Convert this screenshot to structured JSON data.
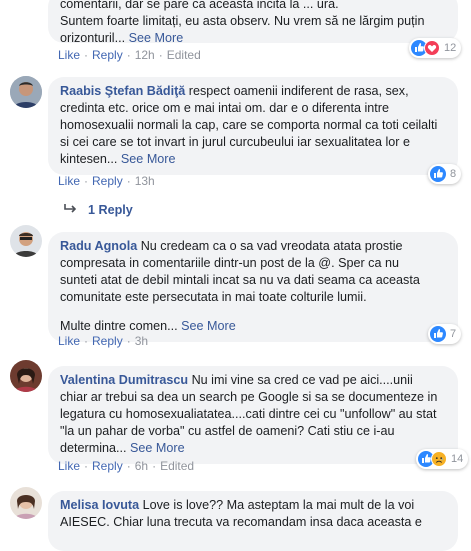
{
  "comments": [
    {
      "author": "",
      "lines": [
        "comentarii, dar se pare ca aceasta incita la ... ura.",
        "Suntem foarte limitați, eu asta observ. Nu vrem să ne lărgim puțin",
        "orizonturil..."
      ],
      "see_more": "See More",
      "like": "Like",
      "reply": "Reply",
      "time": "12h",
      "edited": "Edited",
      "reactions": {
        "icons": [
          "like-icon",
          "love-icon"
        ],
        "count": "12"
      }
    },
    {
      "author": "Raabis Ştefan Bădiţă",
      "lines": [
        " respect oamenii indiferent de rasa, sex,",
        "credinta etc. orice om e mai intai om. dar e o diferenta intre",
        "homosexualii normali la cap, care se comporta normal ca toti ceilalti",
        "si cei care se tot invart in jurul curcubeului iar sexualitatea lor e",
        "kintesen..."
      ],
      "see_more": "See More",
      "like": "Like",
      "reply": "Reply",
      "time": "13h",
      "reactions": {
        "icons": [
          "like-icon"
        ],
        "count": "8"
      },
      "replies_link": "1 Reply"
    },
    {
      "author": "Radu Agnola",
      "lines": [
        " Nu credeam ca o sa vad vreodata atata prostie",
        "compresata in comentariile dintr-un post de la @. Sper ca nu",
        "sunteti atat de debil mintali incat sa nu va dati seama ca aceasta",
        "comunitate este persecutata in mai toate colturile lumii."
      ],
      "extra_line": "Multe dintre comen...",
      "see_more": "See More",
      "like": "Like",
      "reply": "Reply",
      "time": "3h",
      "reactions": {
        "icons": [
          "like-icon"
        ],
        "count": "7"
      }
    },
    {
      "author": "Valentina Dumitrascu",
      "lines": [
        " Nu imi vine sa cred ce vad pe aici....unii",
        "chiar ar trebui sa dea un search pe Google si sa se documenteze in",
        "legatura cu homosexualiatatea....cati dintre cei cu \"unfollow\" au stat",
        "\"la un pahar de vorba\" cu astfel de oameni? Cati stiu ce i-au",
        "determina..."
      ],
      "see_more": "See More",
      "like": "Like",
      "reply": "Reply",
      "time": "6h",
      "edited": "Edited",
      "reactions": {
        "icons": [
          "like-icon",
          "sad-icon"
        ],
        "count": "14"
      }
    },
    {
      "author": "Melisa Iovuta",
      "lines": [
        " Love is love?? Ma asteptam la mai mult de la voi",
        "AIESEC. Chiar luna trecuta va recomandam insa daca aceasta e"
      ]
    }
  ],
  "colors": {
    "link": "#385898",
    "action": "#4267b2",
    "bubble": "#f2f3f5",
    "muted": "#90949c"
  }
}
